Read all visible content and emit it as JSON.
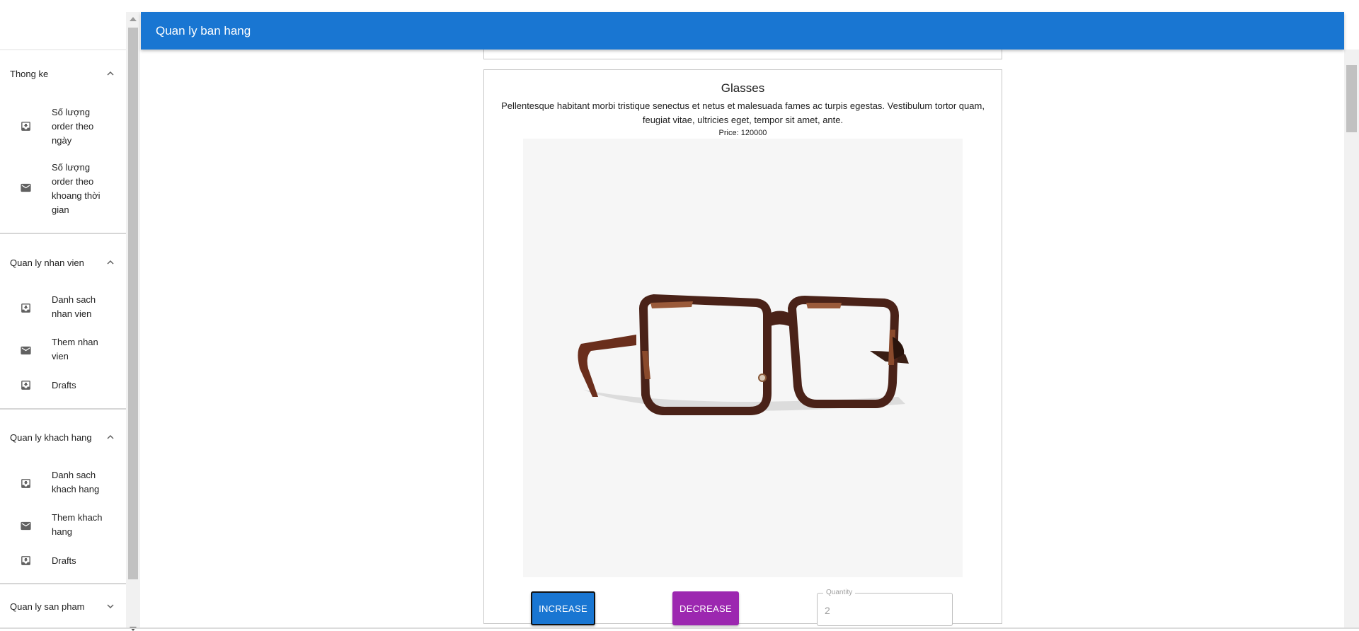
{
  "app": {
    "title": "Quan ly ban hang"
  },
  "sidebar": {
    "sections": [
      {
        "title": "Thong ke",
        "expanded": true,
        "items": [
          {
            "label": "Số lượng order theo ngày",
            "icon": "inbox-icon"
          },
          {
            "label": "Số lượng order theo khoang thời gian",
            "icon": "mail-icon"
          }
        ]
      },
      {
        "title": "Quan ly nhan vien",
        "expanded": true,
        "items": [
          {
            "label": "Danh sach nhan vien",
            "icon": "inbox-icon"
          },
          {
            "label": "Them nhan vien",
            "icon": "mail-icon"
          },
          {
            "label": "Drafts",
            "icon": "inbox-icon"
          }
        ]
      },
      {
        "title": "Quan ly khach hang",
        "expanded": true,
        "items": [
          {
            "label": "Danh sach khach hang",
            "icon": "inbox-icon"
          },
          {
            "label": "Them khach hang",
            "icon": "mail-icon"
          },
          {
            "label": "Drafts",
            "icon": "inbox-icon"
          }
        ]
      },
      {
        "title": "Quan ly san pham",
        "expanded": false,
        "items": []
      }
    ]
  },
  "product": {
    "name": "Glasses",
    "description": "Pellentesque habitant morbi tristique senectus et netus et malesuada fames ac turpis egestas. Vestibulum tortor quam, feugiat vitae, ultricies eget, tempor sit amet, ante.",
    "price": "Price: 120000",
    "image_icon": "glasses-image",
    "increase_label": "INCREASE",
    "decrease_label": "DECREASE",
    "quantity_label": "Quantity",
    "quantity_value": "2"
  },
  "colors": {
    "appbar": "#1976d2",
    "increase": "#1976d2",
    "decrease": "#9c27b0"
  }
}
